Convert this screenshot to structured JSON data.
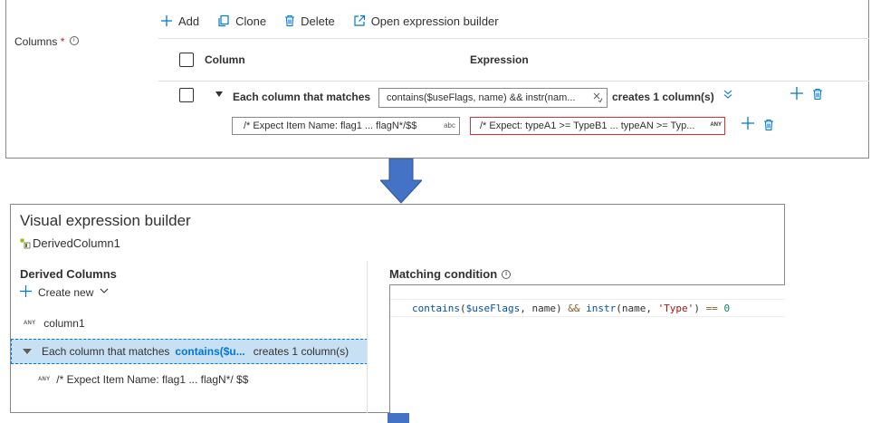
{
  "columns_field": {
    "label": "Columns",
    "required_mark": "*",
    "info_glyph": "i"
  },
  "toolbar": {
    "add_label": "Add",
    "clone_label": "Clone",
    "delete_label": "Delete",
    "open_builder_label": "Open expression builder"
  },
  "table": {
    "col_header": "Column",
    "expr_header": "Expression",
    "row": {
      "match_label": "Each column that matches",
      "match_expression": "contains($useFlags, name) && instr(nam...",
      "creates_label": "creates 1 column(s)",
      "name_value": "/* Expect Item Name: flag1 ... flagN*/$$",
      "name_type_tag": "abc",
      "expr_value": "/* Expect: typeA1 >= TypeB1 ... typeAN >= Typ...",
      "expr_type_tag": "ANY"
    }
  },
  "builder": {
    "title": "Visual expression builder",
    "subtitle": "DerivedColumn1",
    "left_title": "Derived Columns",
    "create_new_label": "Create new",
    "items": [
      {
        "type_tag": "ANY",
        "label": "column1"
      }
    ],
    "selected_item": {
      "label": "Each column that matches",
      "expression": "contains($u...",
      "creates": "creates 1 column(s)"
    },
    "sub_item": {
      "type_tag": "ANY",
      "label": "/* Expect Item Name: flag1 ... flagN*/ $$"
    },
    "right_title": "Matching condition",
    "code": {
      "fn1": "contains",
      "p1": "(",
      "var": "$useFlags",
      "p2": ", name) ",
      "op": "&&",
      "p3": " ",
      "fn2": "instr",
      "p4": "(name, ",
      "str": "'Type'",
      "p5": ") ",
      "eq": "==",
      "p6": " ",
      "num": "0"
    }
  },
  "colors": {
    "accent": "#0078d4",
    "arrow": "#4472c4",
    "error_border": "#d13438",
    "selected_bg": "#c7e0f4"
  }
}
